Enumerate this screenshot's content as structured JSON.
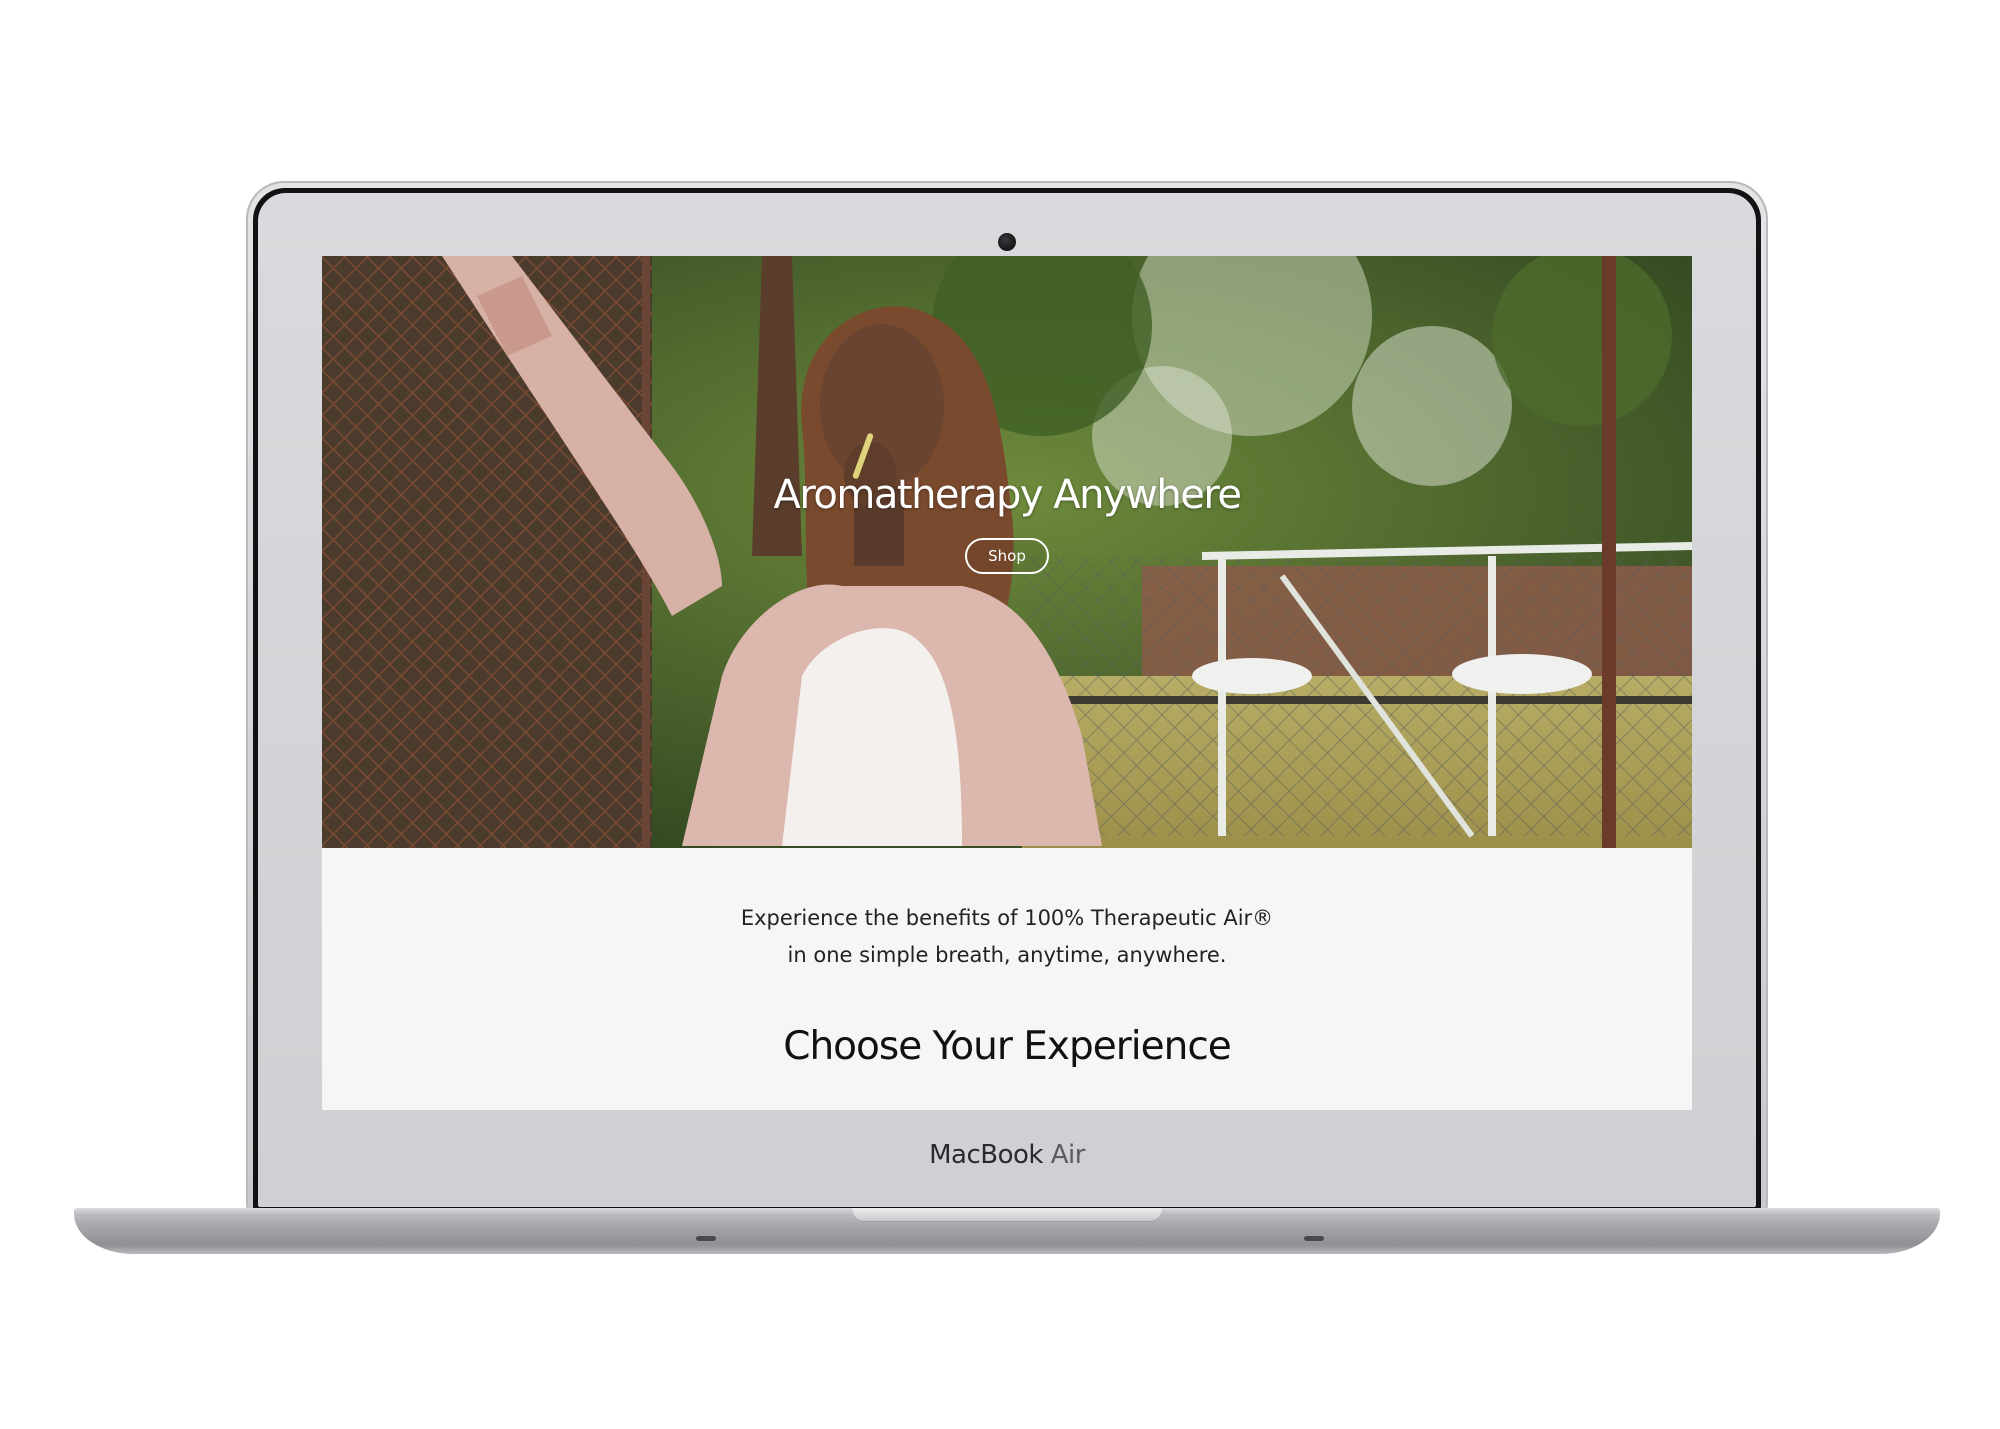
{
  "device": {
    "brand": "MacBook",
    "model": "Air"
  },
  "hero": {
    "title": "Aromatherapy Anywhere",
    "shop_label": "Shop"
  },
  "intro": {
    "line1": "Experience the benefits of 100% Therapeutic Air®",
    "line2": "in one simple breath, anytime, anywhere."
  },
  "section": {
    "title": "Choose Your Experience"
  },
  "colors": {
    "page_background": "#f6f6f6",
    "text_dark": "#222222",
    "hero_text": "#ffffff"
  }
}
